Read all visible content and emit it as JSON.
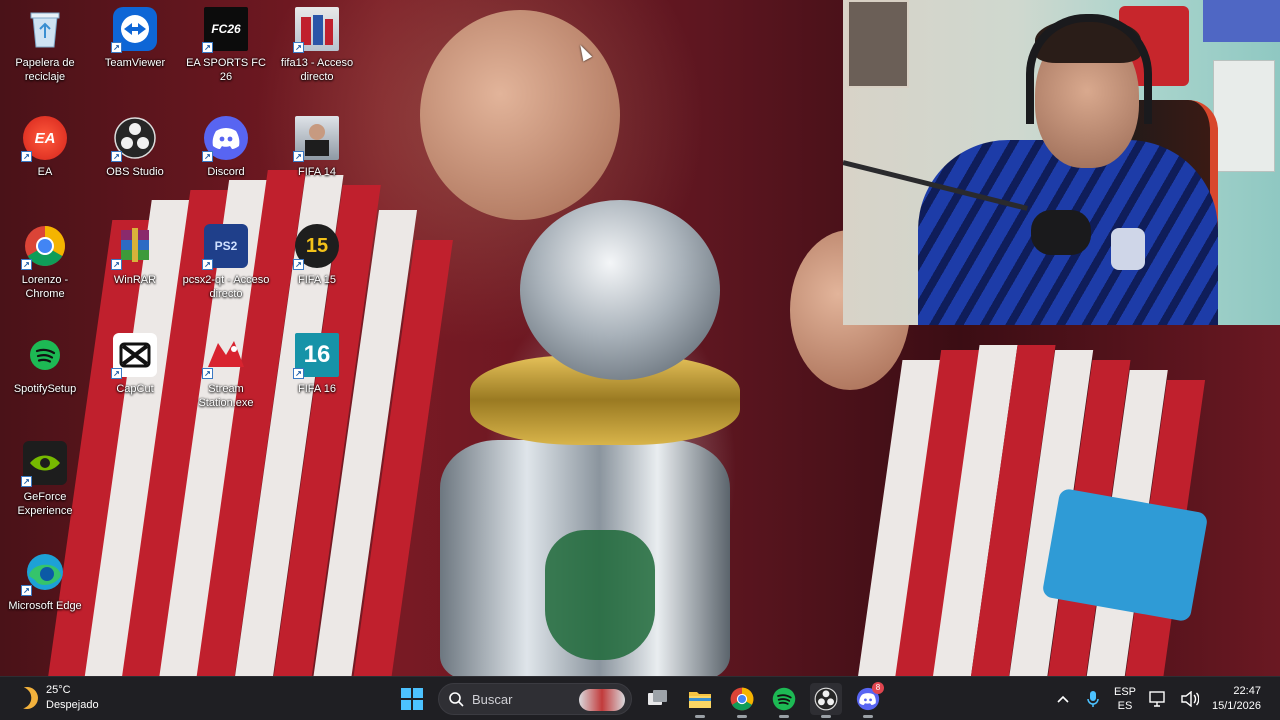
{
  "desktop_icons": [
    {
      "label": "Papelera de reciclaje",
      "icon": "recycle-bin-icon"
    },
    {
      "label": "TeamViewer",
      "icon": "teamviewer-icon"
    },
    {
      "label": "EA SPORTS FC 26",
      "icon": "fc26-icon",
      "glyph": "FC26"
    },
    {
      "label": "fifa13 - Acceso directo",
      "icon": "fifa13-icon"
    },
    {
      "label": "EA",
      "icon": "ea-app-icon",
      "glyph": "EA"
    },
    {
      "label": "OBS Studio",
      "icon": "obs-icon"
    },
    {
      "label": "Discord",
      "icon": "discord-icon"
    },
    {
      "label": "FIFA 14",
      "icon": "fifa14-icon"
    },
    {
      "label": "Lorenzo - Chrome",
      "icon": "chrome-icon"
    },
    {
      "label": "WinRAR",
      "icon": "winrar-icon"
    },
    {
      "label": "pcsx2-qt - Acceso directo",
      "icon": "pcsx2-icon",
      "glyph": "PS2"
    },
    {
      "label": "FIFA 15",
      "icon": "fifa15-icon",
      "glyph": "15"
    },
    {
      "label": "SpotifySetup",
      "icon": "spotify-icon"
    },
    {
      "label": "CapCut",
      "icon": "capcut-icon"
    },
    {
      "label": "Stream Station.exe",
      "icon": "stream-station-icon"
    },
    {
      "label": "FIFA 16",
      "icon": "fifa16-icon",
      "glyph": "16"
    },
    {
      "label": "GeForce Experience",
      "icon": "geforce-icon"
    },
    {
      "label": "Microsoft Edge",
      "icon": "edge-icon"
    }
  ],
  "taskbar": {
    "weather": {
      "temperature": "25°C",
      "condition": "Despejado"
    },
    "search_placeholder": "Buscar",
    "apps": [
      {
        "name": "start-button",
        "icon": "windows-icon"
      },
      {
        "name": "task-view-button",
        "icon": "task-view-icon"
      },
      {
        "name": "file-explorer-button",
        "icon": "folder-icon"
      },
      {
        "name": "chrome-button",
        "icon": "chrome-icon"
      },
      {
        "name": "spotify-button",
        "icon": "spotify-icon"
      },
      {
        "name": "obs-button",
        "icon": "obs-icon"
      },
      {
        "name": "discord-button",
        "icon": "discord-icon",
        "badge": "8"
      }
    ],
    "tray": {
      "language_line1": "ESP",
      "language_line2": "ES",
      "time": "22:47",
      "date": "15/1/2026"
    }
  },
  "colors": {
    "taskbar_bg": "#1f1f23",
    "jersey_red": "#c0202d",
    "jersey_white": "#ece8e6",
    "argentina_blue": "#1d3ca8"
  }
}
